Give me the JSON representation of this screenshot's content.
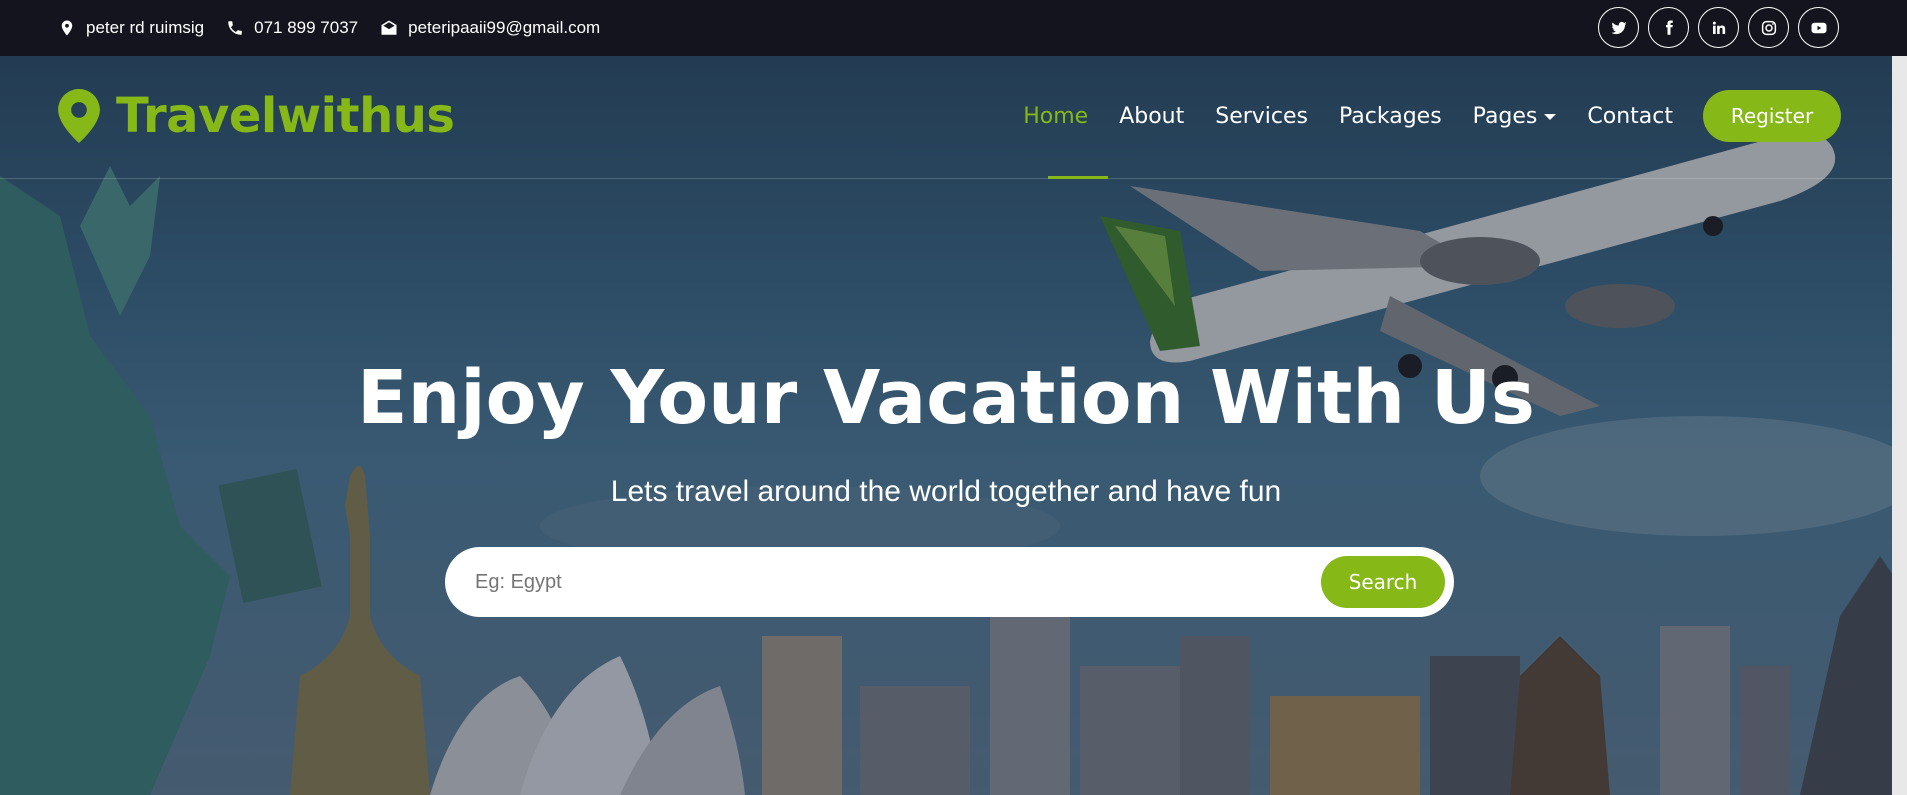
{
  "topbar": {
    "address": "peter rd ruimsig",
    "phone": "071 899 7037",
    "email": "peteripaaii99@gmail.com",
    "address_icon": "map-marker-icon",
    "phone_icon": "phone-icon",
    "email_icon": "envelope-open-icon",
    "social": [
      "twitter-icon",
      "facebook-icon",
      "linkedin-icon",
      "instagram-icon",
      "youtube-icon"
    ]
  },
  "brand": {
    "name": "Travelwithus",
    "icon": "map-marker-icon",
    "color": "#86b817"
  },
  "nav": {
    "items": [
      {
        "label": "Home",
        "active": true
      },
      {
        "label": "About"
      },
      {
        "label": "Services"
      },
      {
        "label": "Packages"
      },
      {
        "label": "Pages",
        "dropdown": true
      },
      {
        "label": "Contact"
      }
    ],
    "register_label": "Register"
  },
  "hero": {
    "headline": "Enjoy Your Vacation With Us",
    "subline": "Lets travel around the world together and have fun",
    "search_placeholder": "Eg: Egypt",
    "search_value": "",
    "search_button": "Search"
  },
  "colors": {
    "accent": "#86b817",
    "topbar_bg": "#14141f"
  }
}
